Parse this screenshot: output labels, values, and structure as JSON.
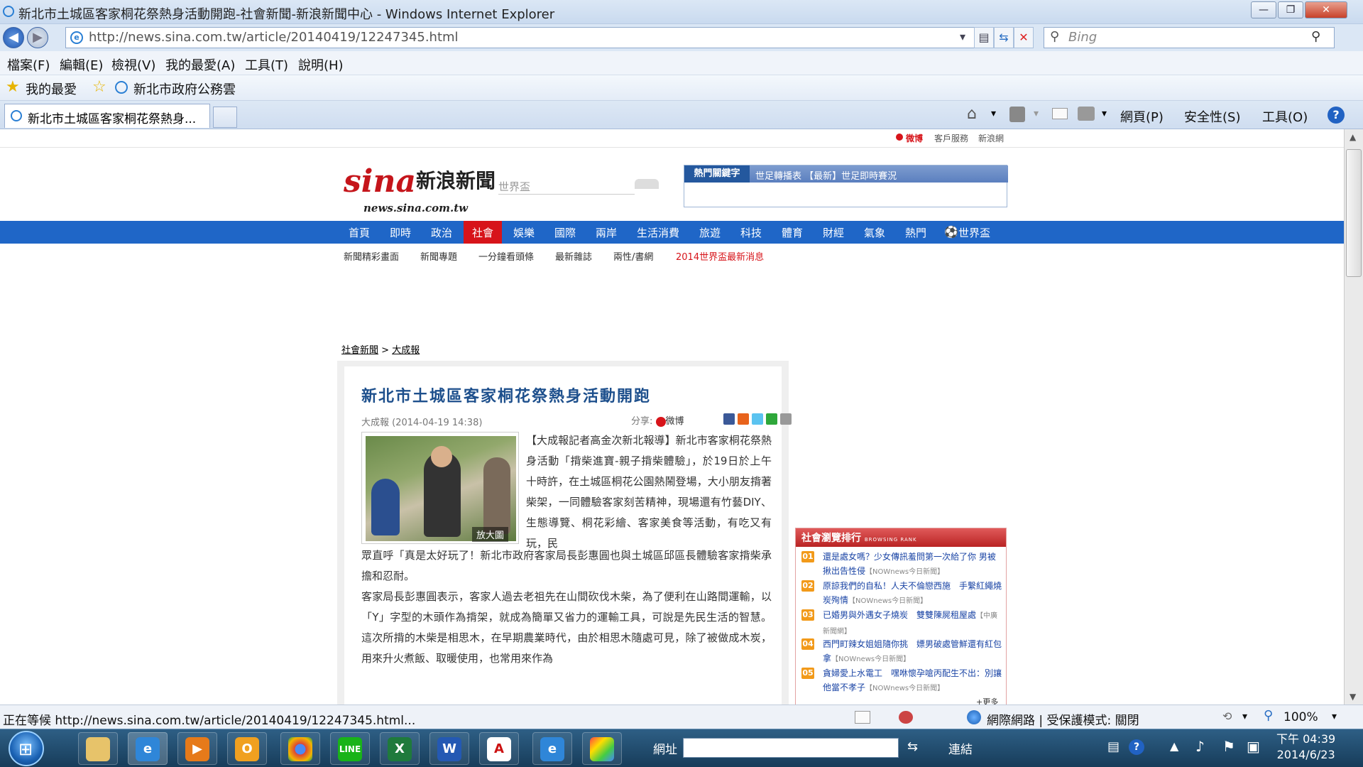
{
  "window": {
    "title": "新北市土城區客家桐花祭熱身活動開跑-社會新聞-新浪新聞中心 - Windows Internet Explorer",
    "min": "—",
    "max": "❐",
    "close": "✕"
  },
  "address": {
    "url": "http://news.sina.com.tw/article/20140419/12247345.html",
    "search_placeholder": "Bing"
  },
  "menu": [
    "檔案(F)",
    "編輯(E)",
    "檢視(V)",
    "我的最愛(A)",
    "工具(T)",
    "說明(H)"
  ],
  "favorites": {
    "label": "我的最愛",
    "item": "新北市政府公務雲"
  },
  "tab": {
    "title": "新北市土城區客家桐花祭熱身...",
    "commands": [
      "網頁(P)",
      "安全性(S)",
      "工具(O)"
    ]
  },
  "site": {
    "topbar": {
      "weibo": "微博",
      "service": "客戶服務",
      "sina": "新浪網"
    },
    "logo": {
      "sina": "sina",
      "name": "新浪新聞",
      "domain": "news.sina.com.tw"
    },
    "search_placeholder": "世界盃",
    "hot": {
      "label": "熱門關鍵字",
      "keywords": "世足轉播表 【最新】世足即時賽況"
    },
    "nav": [
      "首頁",
      "即時",
      "政治",
      "社會",
      "娛樂",
      "國際",
      "兩岸",
      "生活消費",
      "旅遊",
      "科技",
      "體育",
      "財經",
      "氣象",
      "熱門",
      "世界盃"
    ],
    "subnav": [
      "新聞精彩畫面",
      "新聞專題",
      "一分鐘看頭條",
      "最新雜誌",
      "兩性/書網",
      "2014世界盃最新消息"
    ],
    "breadcrumb": {
      "section": "社會新聞",
      "sep": " > ",
      "source": "大成報"
    }
  },
  "article": {
    "title": "新北市土城區客家桐花祭熱身活動開跑",
    "meta": "大成報 (2014-04-19 14:38)",
    "share_label": "分享:",
    "weibo": "微博",
    "enlarge": "放大圖",
    "p1a": "【大成報記者高金次新北報導】新北市客家桐花祭熱身活動「揹柴進寶-親子揹柴體驗」，於19日於上午十時許，在土城區桐花公園熱鬧登場，大小朋友揹著柴架，一同體驗客家刻苦精神，現場還有竹藝DIY、生態導覽、桐花彩繪、客家美食等活動，有吃又有玩，民",
    "p1b": "眾直呼「真是太好玩了！新北市政府客家局長彭惠圓也與土城區邱區長體驗客家揹柴承擔和忍耐。",
    "p2": "客家局長彭惠圓表示，客家人過去老祖先在山間砍伐木柴，為了便利在山路間運輸，以「Y」字型的木頭作為揹架，就成為簡單又省力的運輸工具，可說是先民生活的智慧。這次所揹的木柴是相思木，在早期農業時代，由於相思木隨處可見，除了被做成木炭，用來升火煮飯、取暖使用，也常用來作為"
  },
  "rank": {
    "title": "社會瀏覽排行",
    "title_en": "BROWSING RANK",
    "items": [
      {
        "num": "01",
        "text": "還是處女嗎？少女傳訊羞問第一次給了你 男被揪出告性侵",
        "src": "【NOWnews今日新聞】"
      },
      {
        "num": "02",
        "text": "原諒我們的自私！人夫不倫戀西施　手繫紅繩燒炭殉情",
        "src": "【NOWnews今日新聞】"
      },
      {
        "num": "03",
        "text": "已婚男與外遇女子燒炭　雙雙陳屍租屋處",
        "src": "【中廣新聞網】"
      },
      {
        "num": "04",
        "text": "西門町辣女姐姐隨你挑　嫖男破處管鮮還有紅包拿",
        "src": "【NOWnews今日新聞】"
      },
      {
        "num": "05",
        "text": "貪婦愛上水電工　嘿咻懷孕嗆丙配生不出：別讓他當不孝子",
        "src": "【NOWnews今日新聞】"
      }
    ],
    "more": "+更多"
  },
  "status": {
    "text": "正在等候 http://news.sina.com.tw/article/20140419/12247345.html...",
    "zone": "網際網路 | 受保護模式: 關閉",
    "zoom": "100%"
  },
  "taskbar": {
    "address_label": "網址",
    "links_label": "連結",
    "time": "下午 04:39",
    "date": "2014/6/23"
  },
  "colors": {
    "sina_red": "#c5151b",
    "nav_blue": "#1f66c7",
    "nav_active": "#d7141a",
    "title_blue": "#1d4f8c"
  }
}
